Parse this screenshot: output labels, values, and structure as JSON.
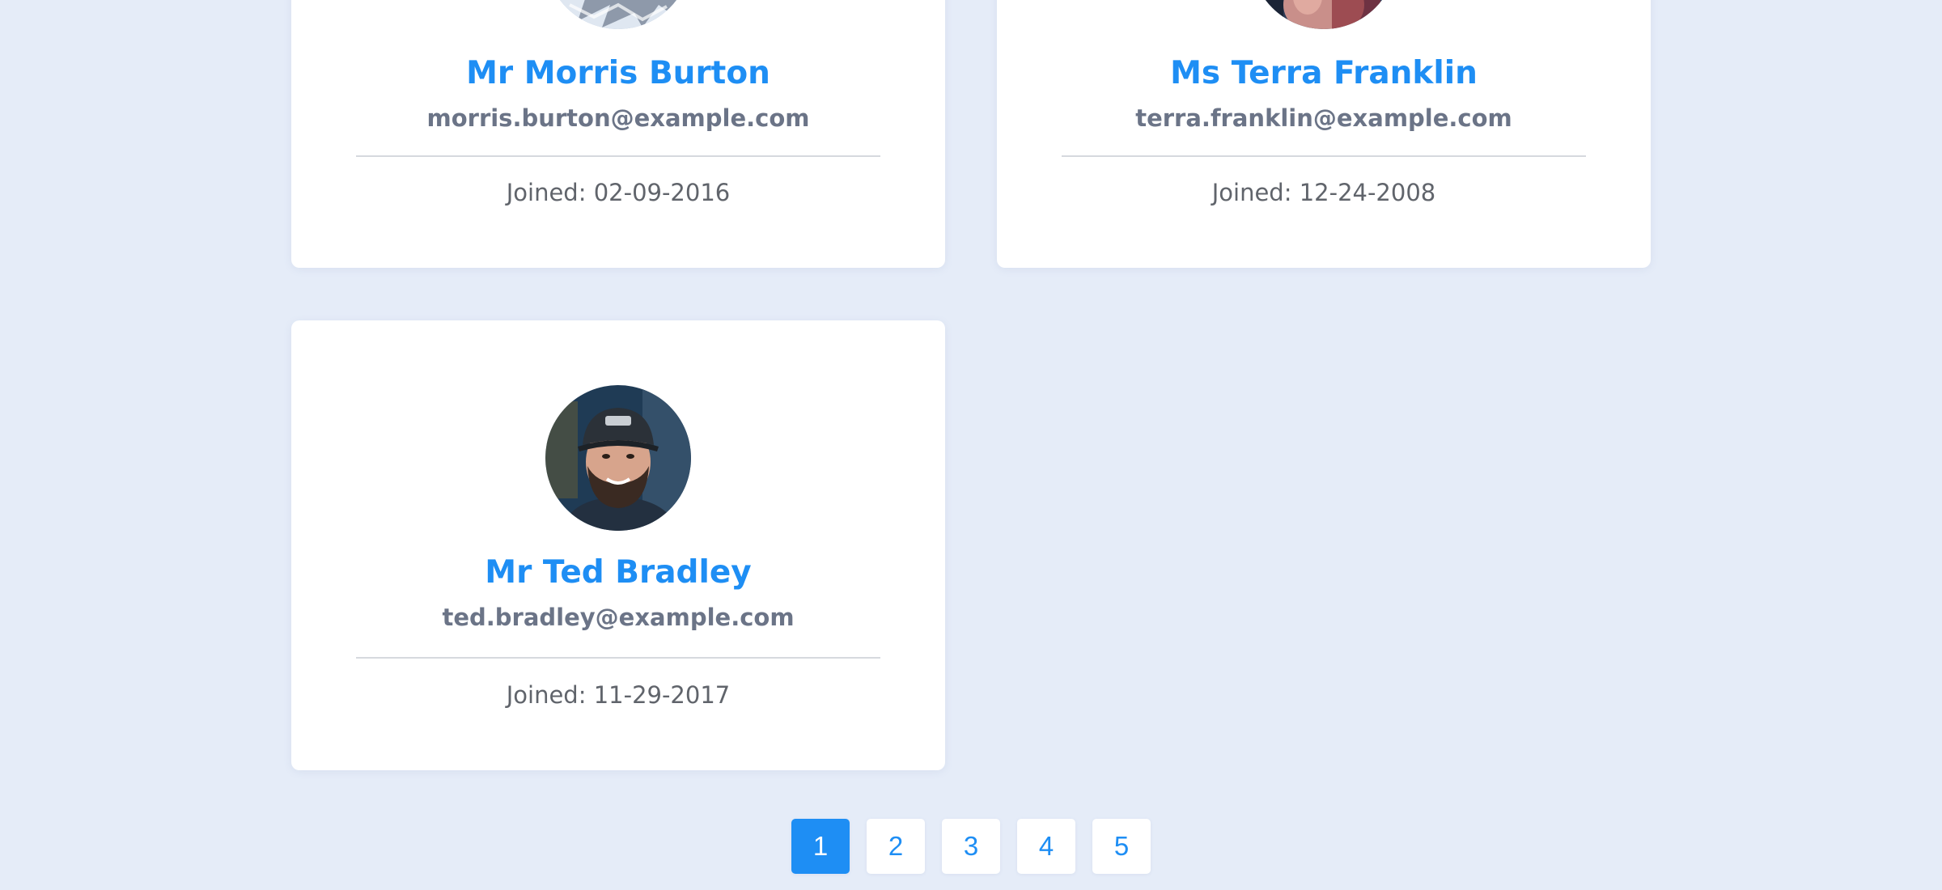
{
  "colors": {
    "background": "#e5ecf8",
    "accent": "#1e8ef4",
    "email_text": "#6b7487",
    "joined_text": "#60646b"
  },
  "users": [
    {
      "name": "Mr Morris Burton",
      "email": "morris.burton@example.com",
      "joined": "Joined: 02-09-2016",
      "avatar": "user-photo"
    },
    {
      "name": "Ms Terra Franklin",
      "email": "terra.franklin@example.com",
      "joined": "Joined: 12-24-2008",
      "avatar": "user-photo"
    },
    {
      "name": "Mr Ted Bradley",
      "email": "ted.bradley@example.com",
      "joined": "Joined: 11-29-2017",
      "avatar": "user-photo"
    }
  ],
  "pagination": {
    "pages": [
      "1",
      "2",
      "3",
      "4",
      "5"
    ],
    "current": "1"
  }
}
